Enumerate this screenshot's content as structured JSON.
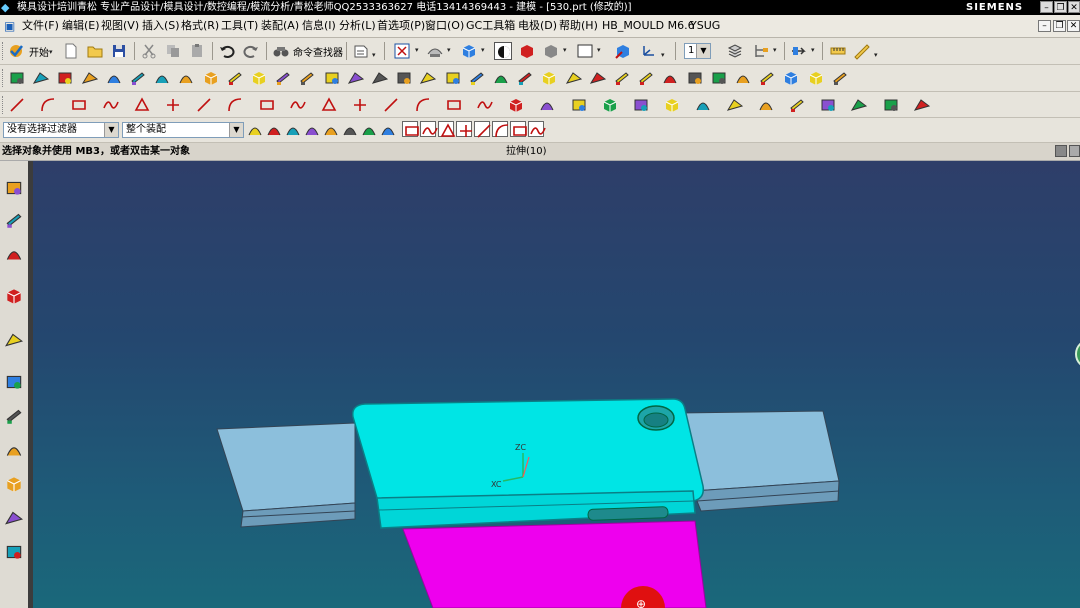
{
  "window": {
    "title": "模具设计培训青松 专业产品设计/模具设计/数控编程/模流分析/青松老师QQ2533363627 电话13414369443 - 建模 - [530.prt (修改的)]",
    "brand": "SIEMENS",
    "controls": [
      "–",
      "❐",
      "✕"
    ]
  },
  "menubar": {
    "items": [
      "文件(F)",
      "编辑(E)",
      "视图(V)",
      "插入(S)",
      "格式(R)",
      "工具(T)",
      "装配(A)",
      "信息(I)",
      "分析(L)",
      "首选项(P)",
      "窗口(O)",
      "GC工具箱",
      "电极(D)",
      "帮助(H)",
      "HB_MOULD M6.6",
      "YSUG"
    ],
    "mdi_controls": [
      "–",
      "❐",
      "✕"
    ]
  },
  "toolbar1": {
    "start_label": "开始",
    "command_finder_label": "命令查找器",
    "layer_value": "1"
  },
  "filterbar": {
    "type_filter_value": "没有选择过滤器",
    "assembly_scope_value": "整个装配"
  },
  "statusbar": {
    "prompt": "选择对象并使用 MB3，或者双击某一对象",
    "status": "拉伸(10)"
  },
  "viewport": {
    "wcs_labels": {
      "z": "ZC",
      "x": "XC"
    },
    "colors": {
      "part": "#00e5e5",
      "part_edge": "#0a7f86",
      "insert": "#ee00ee",
      "rail": "#88b8d6",
      "background_top": "#2e3e69",
      "background_bottom": "#1a687a"
    }
  },
  "icons": {
    "toolbar1": [
      "undo-icon",
      "redo-icon",
      "layer-settings-icon",
      "fit-view-icon",
      "zoom-icon",
      "shaded-cube-icon",
      "display-mode-icon",
      "shaded-edges-icon",
      "wireframe-icon",
      "background-icon",
      "show-hide-icon",
      "csys-icon",
      "layer-icon",
      "assembly-nav-icon",
      "move-component-icon",
      "measure-icon",
      "ruler-icon"
    ],
    "toolbar2": [
      "sketch-icon",
      "datum-plane-icon",
      "extrude-icon",
      "revolve-icon",
      "hole-icon",
      "boss-icon",
      "block-icon",
      "cylinder-icon",
      "cone-icon",
      "sphere-icon",
      "edge-blend-icon",
      "chamfer-icon",
      "shell-icon",
      "draft-icon",
      "unite-icon",
      "subtract-icon",
      "intersect-icon",
      "trim-body-icon",
      "split-body-icon",
      "offset-face-icon",
      "thicken-icon",
      "pattern-icon",
      "mirror-icon",
      "surface-icon",
      "sweep-icon",
      "through-curves-icon",
      "n-sided-icon",
      "bounded-plane-icon",
      "patch-icon",
      "sew-icon",
      "extract-icon",
      "replace-face-icon",
      "delete-face-icon",
      "move-face-icon",
      "resize-face-icon"
    ],
    "toolbar3": [
      "line-icon",
      "arc-icon",
      "rectangle-icon",
      "spline-icon",
      "polygon-icon",
      "offset-curve-icon",
      "bridge-curve-icon",
      "project-curve-icon",
      "intersect-curve-icon",
      "extract-curve-icon",
      "trim-curve-icon",
      "divide-curve-icon",
      "fillet-curve-icon",
      "join-curve-icon",
      "isoparametric-icon",
      "wrap-icon",
      "snap-endpoint-icon",
      "snap-midpoint-icon",
      "snap-point-icon",
      "snap-intersection-icon",
      "snap-center-icon",
      "snap-quadrant-icon",
      "face-analysis-icon",
      "section-icon",
      "curvature-icon",
      "draft-analysis-icon",
      "deviation-icon",
      "highlight-icon",
      "reflection-icon",
      "wcs-origin-icon"
    ],
    "filterbar": [
      "snap-icon",
      "point-icon",
      "vertex-icon",
      "edge-icon",
      "face-icon",
      "body-icon",
      "select-all-icon",
      "box-select-icon",
      "lasso-icon",
      "arrow-point-icon",
      "cross-icon",
      "circle-icon",
      "crosshair-icon",
      "curve-point-icon",
      "end-point-icon",
      "wcs-icon"
    ],
    "resource_bar": [
      "assembly-navigator-icon",
      "constraint-navigator-icon",
      "part-navigator-icon",
      "reuse-library-icon",
      "web-browser-icon",
      "history-icon",
      "system-materials-icon",
      "process-studio-icon",
      "manufacturing-wizard-icon",
      "roles-icon",
      "system-scenes-icon"
    ]
  }
}
